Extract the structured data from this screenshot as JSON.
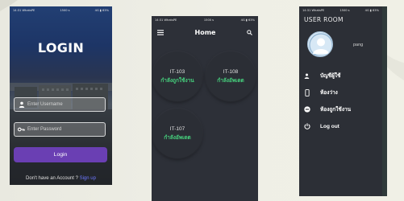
{
  "colors": {
    "accent_purple": "#6a3fb3",
    "signup_link": "#6d78ff",
    "available_green": "#46d07d",
    "dark_panel": "#2d3038"
  },
  "login_screen": {
    "status_bar": {
      "time": "14:31 WhatsPE",
      "center": "1500 s",
      "right": "4G ▮ 63%"
    },
    "title": "LOGIN",
    "username_field": {
      "placeholder": "Enter Username",
      "icon": "user-icon"
    },
    "password_field": {
      "placeholder": "Enter Password",
      "icon": "key-icon"
    },
    "login_button_label": "Login",
    "signup_prompt": "Don't have an Account ? ",
    "signup_link": "Sign up"
  },
  "home_screen": {
    "status_bar": {
      "time": "14:31 WhatsPE",
      "center": "1500 s",
      "right": "4G ▮ 63%"
    },
    "menu_icon": "hamburger-menu-icon",
    "title": "Home",
    "search_icon": "search-icon",
    "rooms": [
      {
        "id": "IT-103",
        "status": "กำลังถูกใช้งาน"
      },
      {
        "id": "IT-108",
        "status": "กำลังอัพเดต"
      },
      {
        "id": "IT-107",
        "status": "กำลังอัพเดต"
      }
    ]
  },
  "drawer_screen": {
    "status_bar": {
      "time": "14:31 WhatsPE",
      "center": "1500 s",
      "right": "4G ▮ 63%"
    },
    "title": "USER ROOM",
    "avatar_icon": "user-avatar-icon",
    "username": "pang",
    "menu_items": [
      {
        "label": "บัญชีผู้ใช้",
        "icon": "person-icon"
      },
      {
        "label": "ห้องว่าง",
        "icon": "phone-icon"
      },
      {
        "label": "ห้องถูกใช้งาน",
        "icon": "minus-circle-icon"
      },
      {
        "label": "Log out",
        "icon": "power-icon"
      }
    ]
  }
}
